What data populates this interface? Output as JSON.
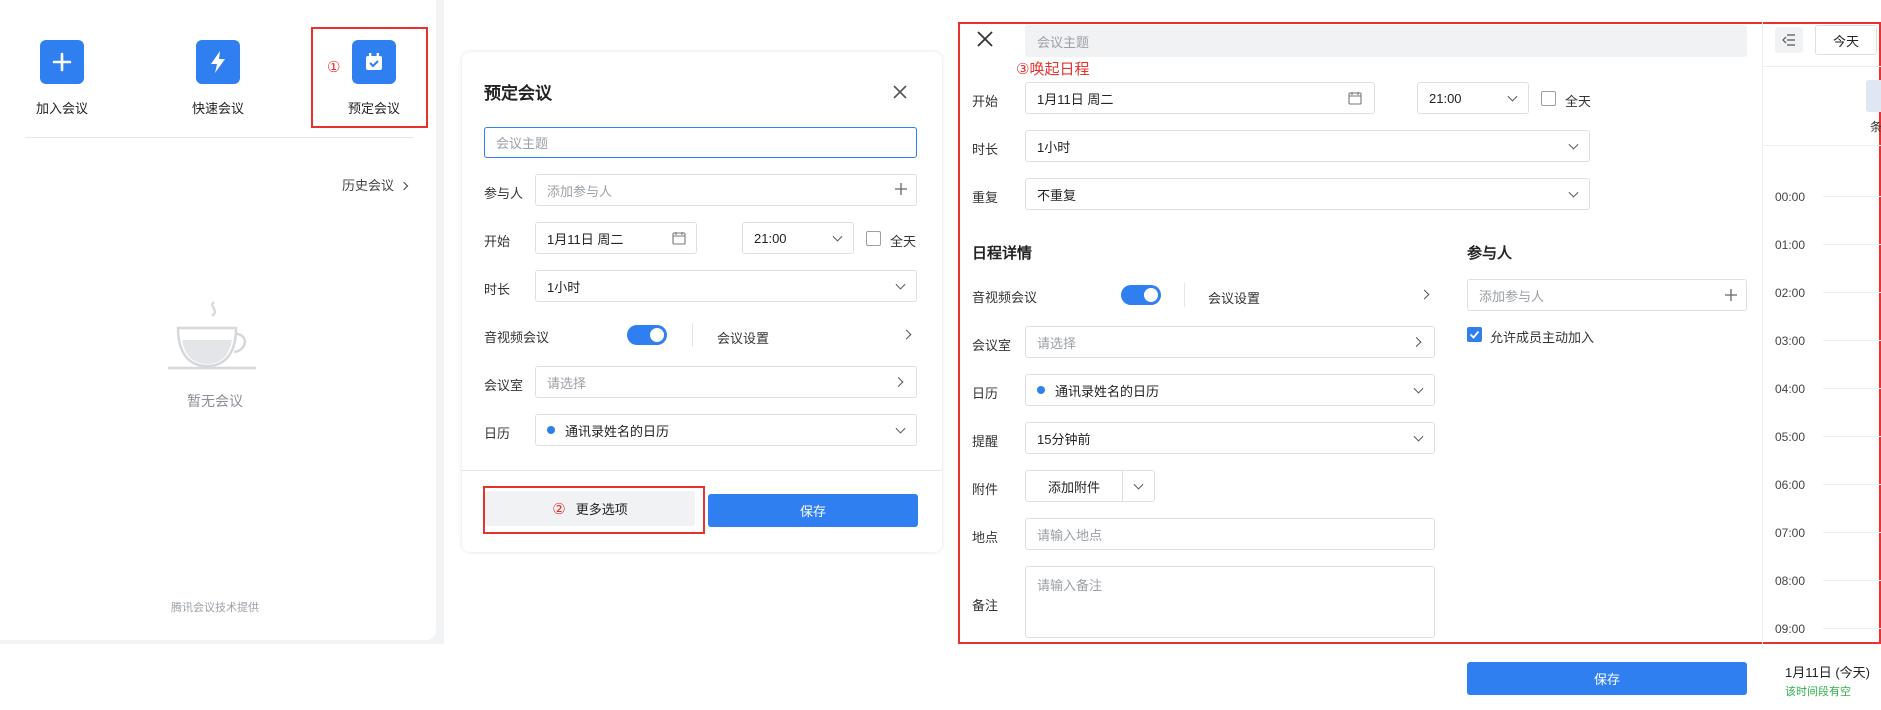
{
  "quick_actions": {
    "join": "加入会议",
    "quick": "快速会议",
    "schedule": "预定会议"
  },
  "annotations": {
    "step1": "①",
    "step2": "②",
    "step3": "③唤起日程"
  },
  "meeting_list": {
    "history_link": "历史会议",
    "empty_text": "暂无会议",
    "footer": "腾讯会议技术提供"
  },
  "dialog": {
    "title": "预定会议",
    "subject_placeholder": "会议主题",
    "participants_label": "参与人",
    "participants_placeholder": "添加参与人",
    "start_label": "开始",
    "start_date": "1月11日 周二",
    "start_time": "21:00",
    "all_day_label": "全天",
    "duration_label": "时长",
    "duration_value": "1小时",
    "av_label": "音视频会议",
    "meeting_settings": "会议设置",
    "room_label": "会议室",
    "room_placeholder": "请选择",
    "calendar_label": "日历",
    "calendar_value": "通讯录姓名的日历",
    "more_options": "更多选项",
    "save": "保存"
  },
  "schedule": {
    "subject_placeholder": "会议主题",
    "start_label": "开始",
    "start_date": "1月11日 周二",
    "start_time": "21:00",
    "all_day_label": "全天",
    "duration_label": "时长",
    "duration_value": "1小时",
    "repeat_label": "重复",
    "repeat_value": "不重复",
    "details_heading": "日程详情",
    "av_label": "音视频会议",
    "meeting_settings": "会议设置",
    "room_label": "会议室",
    "room_placeholder": "请选择",
    "calendar_label": "日历",
    "calendar_value": "通讯录姓名的日历",
    "reminder_label": "提醒",
    "reminder_value": "15分钟前",
    "attachment_label": "附件",
    "attachment_button": "添加附件",
    "location_label": "地点",
    "location_placeholder": "请输入地点",
    "notes_label": "备注",
    "notes_placeholder": "请输入备注",
    "participants_heading": "参与人",
    "participants_placeholder": "添加参与人",
    "allow_join_label": "允许成员主动加入",
    "save": "保存"
  },
  "calendar": {
    "today_button": "今天",
    "hours": [
      "00:00",
      "01:00",
      "02:00",
      "03:00",
      "04:00",
      "05:00",
      "06:00",
      "07:00",
      "08:00",
      "09:00"
    ],
    "date_status": "1月11日 (今天)",
    "free_text": "该时间段有空",
    "cut_glyph": "条"
  },
  "colors": {
    "accent": "#2f7ff0",
    "annotation_red": "#e8322f",
    "free_green": "#2eb24a"
  }
}
